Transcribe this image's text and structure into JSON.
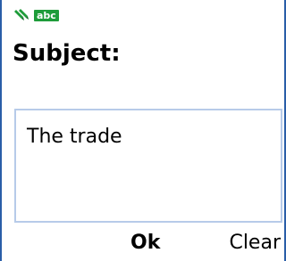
{
  "status_bar": {
    "input_icon": "pen-icon",
    "input_mode": "abc",
    "colors": {
      "pen": "#1e9c3a",
      "mode_badge_bg": "#1e9c3a",
      "mode_badge_text": "#ffffff"
    }
  },
  "form": {
    "label": "Subject:",
    "value": "The trade"
  },
  "softkeys": {
    "center": "Ok",
    "right": "Clear"
  },
  "colors": {
    "frame_border": "#2a5ea8",
    "input_border": "#b7cbe9"
  }
}
